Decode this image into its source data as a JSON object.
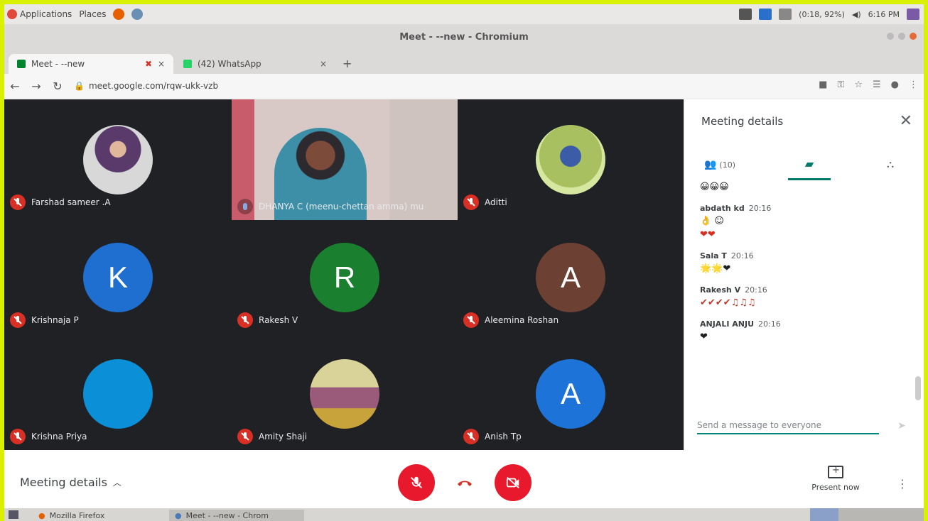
{
  "system_bar": {
    "apps_label": "Applications",
    "places_label": "Places",
    "clock": "6:16 PM",
    "battery": "(0:18, 92%)"
  },
  "window": {
    "title": "Meet - --new - Chromium"
  },
  "tabs": [
    {
      "label": "Meet - --new",
      "active": true
    },
    {
      "label": "(42) WhatsApp",
      "active": false
    }
  ],
  "address_bar": {
    "url": "meet.google.com/rqw-ukk-vzb"
  },
  "participants": [
    {
      "name": "Farshad sameer .A",
      "avatar_type": "photo",
      "mic": "off"
    },
    {
      "name": "DHANYA C (meenu-chettan amma) mu",
      "avatar_type": "video",
      "mic": "on"
    },
    {
      "name": "Aditti",
      "avatar_type": "photo",
      "mic": "off"
    },
    {
      "name": "Krishnaja P",
      "avatar_type": "letter",
      "letter": "K",
      "color": "#1e6fd0",
      "mic": "off"
    },
    {
      "name": "Rakesh V",
      "avatar_type": "letter",
      "letter": "R",
      "color": "#1a7f2e",
      "mic": "off"
    },
    {
      "name": "Aleemina Roshan",
      "avatar_type": "letter",
      "letter": "A",
      "color": "#6d4034",
      "mic": "off"
    },
    {
      "name": "Krishna Priya",
      "avatar_type": "blank",
      "color": "#0b8fd6",
      "mic": "off"
    },
    {
      "name": "Amity Shaji",
      "avatar_type": "photo",
      "mic": "off"
    },
    {
      "name": "Anish Tp",
      "avatar_type": "letter",
      "letter": "A",
      "color": "#1e73d8",
      "mic": "off"
    }
  ],
  "panel": {
    "title": "Meeting details",
    "tabs": {
      "people_count": "(10)"
    },
    "messages": [
      {
        "sender": "",
        "time": "",
        "text": "😀😀😀"
      },
      {
        "sender": "abdath kd",
        "time": "20:16",
        "text": "👌 ☺",
        "extra": "❤❤"
      },
      {
        "sender": "Sala T",
        "time": "20:16",
        "text": "🌟🌟❤"
      },
      {
        "sender": "Rakesh V",
        "time": "20:16",
        "text": "✔✔✔✔♫♫♫"
      },
      {
        "sender": "ANJALI ANJU",
        "time": "20:16",
        "text": "❤"
      }
    ],
    "composer_placeholder": "Send a message to everyone"
  },
  "bottom_bar": {
    "details_label": "Meeting details",
    "present_label": "Present now"
  },
  "taskbar": [
    {
      "label": "Mozilla Firefox",
      "active": false
    },
    {
      "label": "Meet - --new - Chrom",
      "active": true
    }
  ]
}
